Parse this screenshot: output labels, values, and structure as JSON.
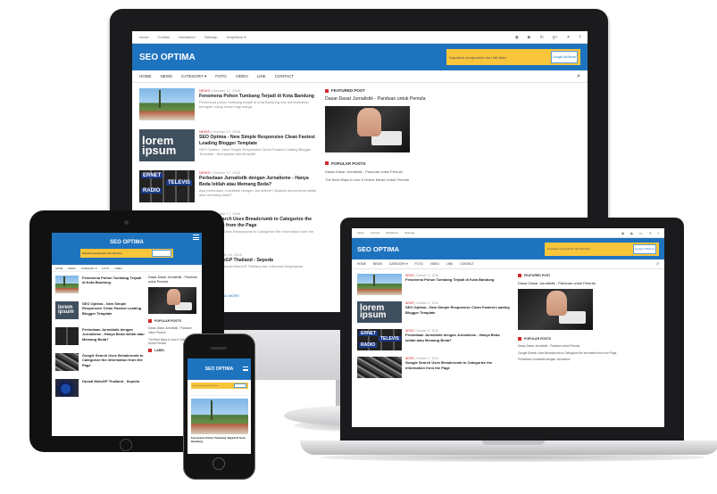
{
  "site": {
    "logo": "SEO OPTIMA",
    "top_links": [
      "About",
      "Contact",
      "Disclaimer",
      "Sitemap",
      "DropMenu ▾"
    ],
    "ad_text": "Dapatkan penghasilan dari klik iklan",
    "ad_badge": "Google AdSense",
    "nav": [
      "HOME",
      "NEWS",
      "CATEGORY ▾",
      "FOTO",
      "VIDEO",
      "LINK",
      "CONTACT"
    ],
    "posts": [
      {
        "cat": "NEWS",
        "date": "October 17, 2016",
        "title": "Fenomena Pohon Tumbang Terjadi di Kota Bandung",
        "excerpt": "Fenomena pohon tumbang terjadi di kota Bandung dan menimbulkan kerugian cukup besar bagi warga"
      },
      {
        "cat": "NEWS",
        "date": "October 17, 2016",
        "title": "SEO Optima - New Simple Responsive Clean Fastest Loading Blogger Template",
        "excerpt": "SEO Optima - New Simple Responsive Clean Fastest Loading Blogger Template - terinspirasi dari template"
      },
      {
        "cat": "NEWS",
        "date": "October 17, 2016",
        "title": "Perbedaan Jurnalistik dengan Jurnalisme - Hanya Beda Istilah atau Memang Beda?",
        "excerpt": "Apa perbedaan Jurnalistik dengan Jurnalisme? Apakah hanya beda istilah atau memang beda?"
      },
      {
        "cat": "NEWS",
        "date": "October 17, 2016",
        "title": "Google Search Uses Breadcrumb to Categorize the information from the Page",
        "excerpt": "Google Search Uses Breadcrumb to Categorize the information from the Page"
      },
      {
        "cat": "SPORT",
        "date": "October 16, 2016",
        "title": "Ducati MotoGP Thailand - Sepeda",
        "excerpt": "Sepeda motor Ducati MotoGP Thailand dan informasi lengkapnya"
      }
    ],
    "side_featured_heading": "FEATURED POST",
    "side_featured_title": "Dasar-Dasar Jurnalistik - Panduan untuk Pemula",
    "side_popular_heading": "POPULAR POSTS",
    "side_popular": [
      "Dasar-Dasar Jurnalistik - Panduan untuk Pemula",
      "The Best Ways to Use It Online Media Untuk Pemula",
      "Google Search Uses Breadcrumb to Categorize the information from the Page",
      "Perbedaan Jurnalistik dengan Jurnalisme"
    ],
    "side_label": "LABEL",
    "load_more": "LOAD MORE"
  },
  "thumb_text": {
    "lorem_1": "lorem",
    "lorem_2": "ipsum",
    "key_1": "ERNET",
    "key_2": "RADIO",
    "key_3": "TELEVIS"
  },
  "colors": {
    "brand": "#1e73be",
    "ad": "#f9c53b",
    "accent": "#d42b2b"
  }
}
